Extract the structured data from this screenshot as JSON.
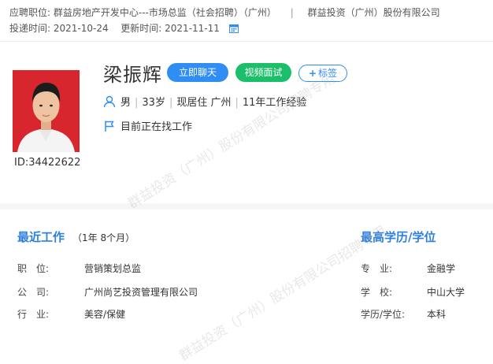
{
  "top": {
    "position_label": "应聘职位:",
    "position_value": "群益房地产开发中心---市场总监（社会招聘）（广州）",
    "separator": "|",
    "company": "群益投资（广州）股份有限公司",
    "sent_label": "投递时间:",
    "sent_value": "2021-10-24",
    "updated_label": "更新时间:",
    "updated_value": "2021-11-11"
  },
  "candidate": {
    "name": "梁振辉",
    "id_text": "ID:34422622",
    "gender": "男",
    "age": "33岁",
    "residence": "现居住 广州",
    "experience": "11年工作经验",
    "status": "目前正在找工作"
  },
  "actions": {
    "chat": "立即聊天",
    "video": "视频面试",
    "tag": "标签"
  },
  "work": {
    "heading": "最近工作",
    "duration": "（1年 8个月）",
    "rows": [
      {
        "label": "职　位:",
        "value": "营销策划总监"
      },
      {
        "label": "公　司:",
        "value": "广州尚艺投资管理有限公司"
      },
      {
        "label": "行　业:",
        "value": "美容/保健"
      }
    ]
  },
  "education": {
    "heading": "最高学历/学位",
    "rows": [
      {
        "label": "专　业:",
        "value": "金融学"
      },
      {
        "label": "学　校:",
        "value": "中山大学"
      },
      {
        "label": "学历/学位:",
        "value": "本科"
      }
    ]
  },
  "watermark": {
    "line1": "群益投资（广州）股份有限公司招聘专用",
    "line2": "群益投资（广州）股份有限公司招聘专用"
  },
  "colors": {
    "primary": "#2f8df3",
    "video": "#1bbf6b",
    "heading": "#2f7fe0",
    "photo_bg": "#d7262e"
  }
}
